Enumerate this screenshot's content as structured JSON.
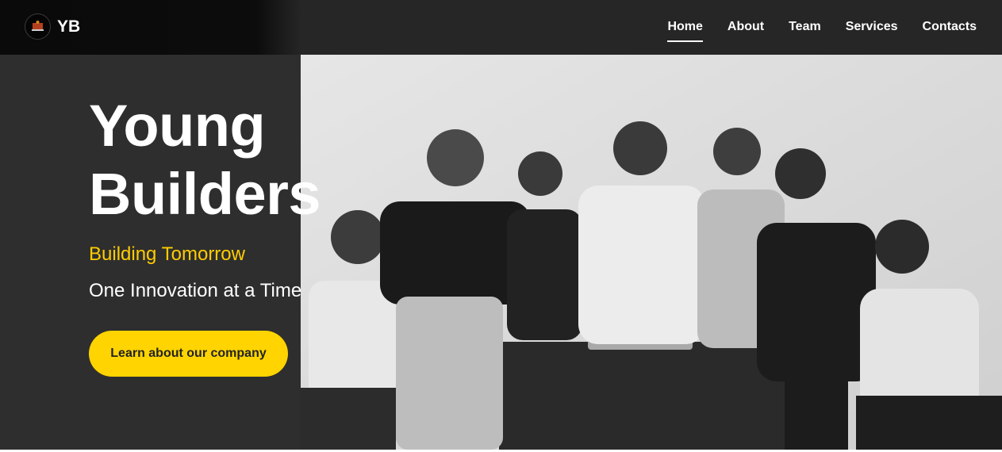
{
  "nav": {
    "brand": "YB",
    "items": [
      {
        "label": "Home",
        "active": true
      },
      {
        "label": "About",
        "active": false
      },
      {
        "label": "Team",
        "active": false
      },
      {
        "label": "Services",
        "active": false
      },
      {
        "label": "Contacts",
        "active": false
      }
    ]
  },
  "hero": {
    "title_line1": "Young",
    "title_line2": "Builders",
    "subtitle": "Building Tomorrow",
    "tagline": "One Innovation at a Time",
    "cta_label": "Learn about our company",
    "photo_icon": "group-photo"
  },
  "colors": {
    "accent": "#ffd400",
    "subtitle": "#ffcc00",
    "background": "#2e2e2e",
    "navbar": "#262626"
  }
}
